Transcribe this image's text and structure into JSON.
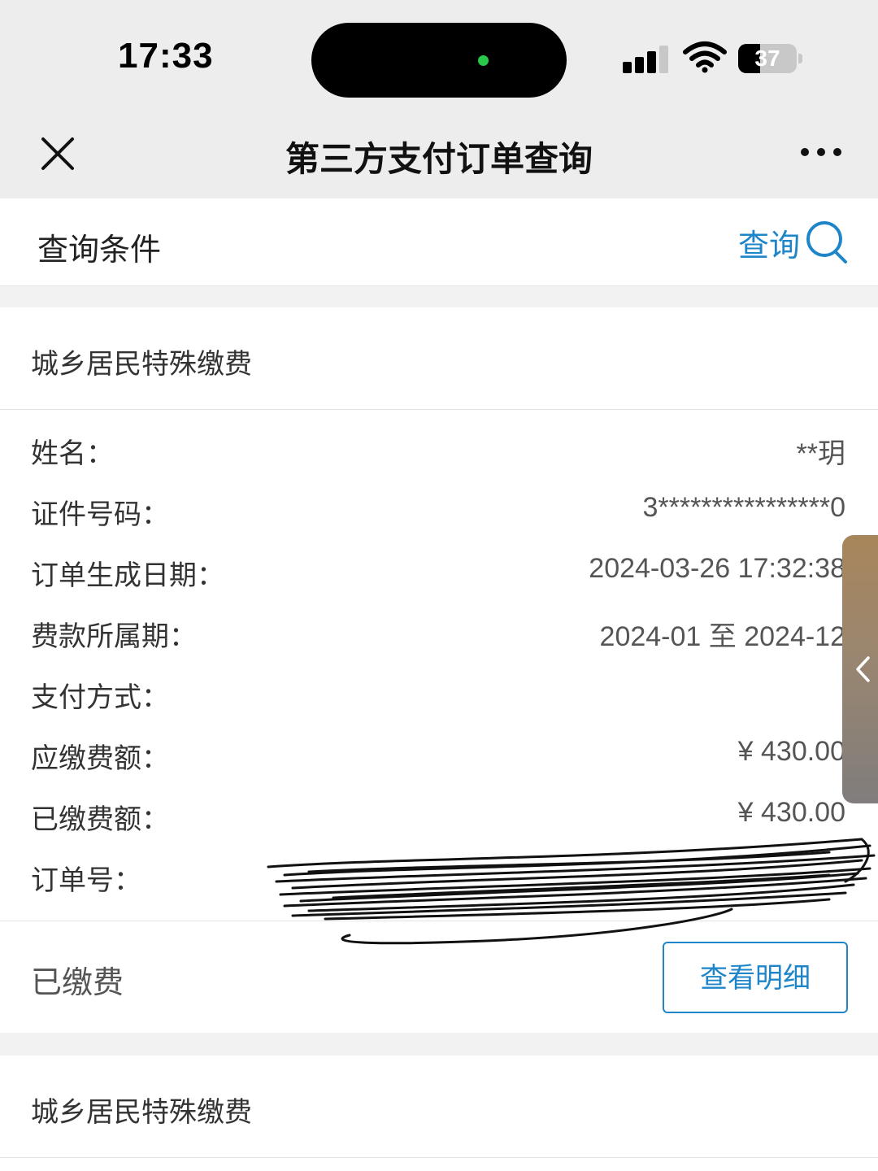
{
  "status_bar": {
    "time": "17:33",
    "battery_level": "37",
    "battery_percent": 37,
    "icons": [
      "signal-icon",
      "wifi-icon",
      "battery-icon"
    ]
  },
  "nav": {
    "title": "第三方支付订单查询",
    "close_icon": "close-icon",
    "more_icon": "more-icon"
  },
  "query": {
    "label": "查询条件",
    "button_label": "查询",
    "accent_color": "#1e86c8"
  },
  "orders": [
    {
      "title": "城乡居民特殊缴费",
      "fields": [
        {
          "label": "姓名：",
          "value": "**玥"
        },
        {
          "label": "证件号码：",
          "value": "3****************0"
        },
        {
          "label": "订单生成日期：",
          "value": "2024-03-26 17:32:38"
        },
        {
          "label": "费款所属期：",
          "value": "2024-01 至 2024-12"
        },
        {
          "label": "支付方式：",
          "value": ""
        },
        {
          "label": "应缴费额：",
          "value": "¥ 430.00"
        },
        {
          "label": "已缴费额：",
          "value": "¥ 430.00"
        },
        {
          "label": "订单号：",
          "value": ""
        }
      ],
      "status": "已缴费",
      "detail_button": "查看明细"
    },
    {
      "title": "城乡居民特殊缴费"
    }
  ]
}
